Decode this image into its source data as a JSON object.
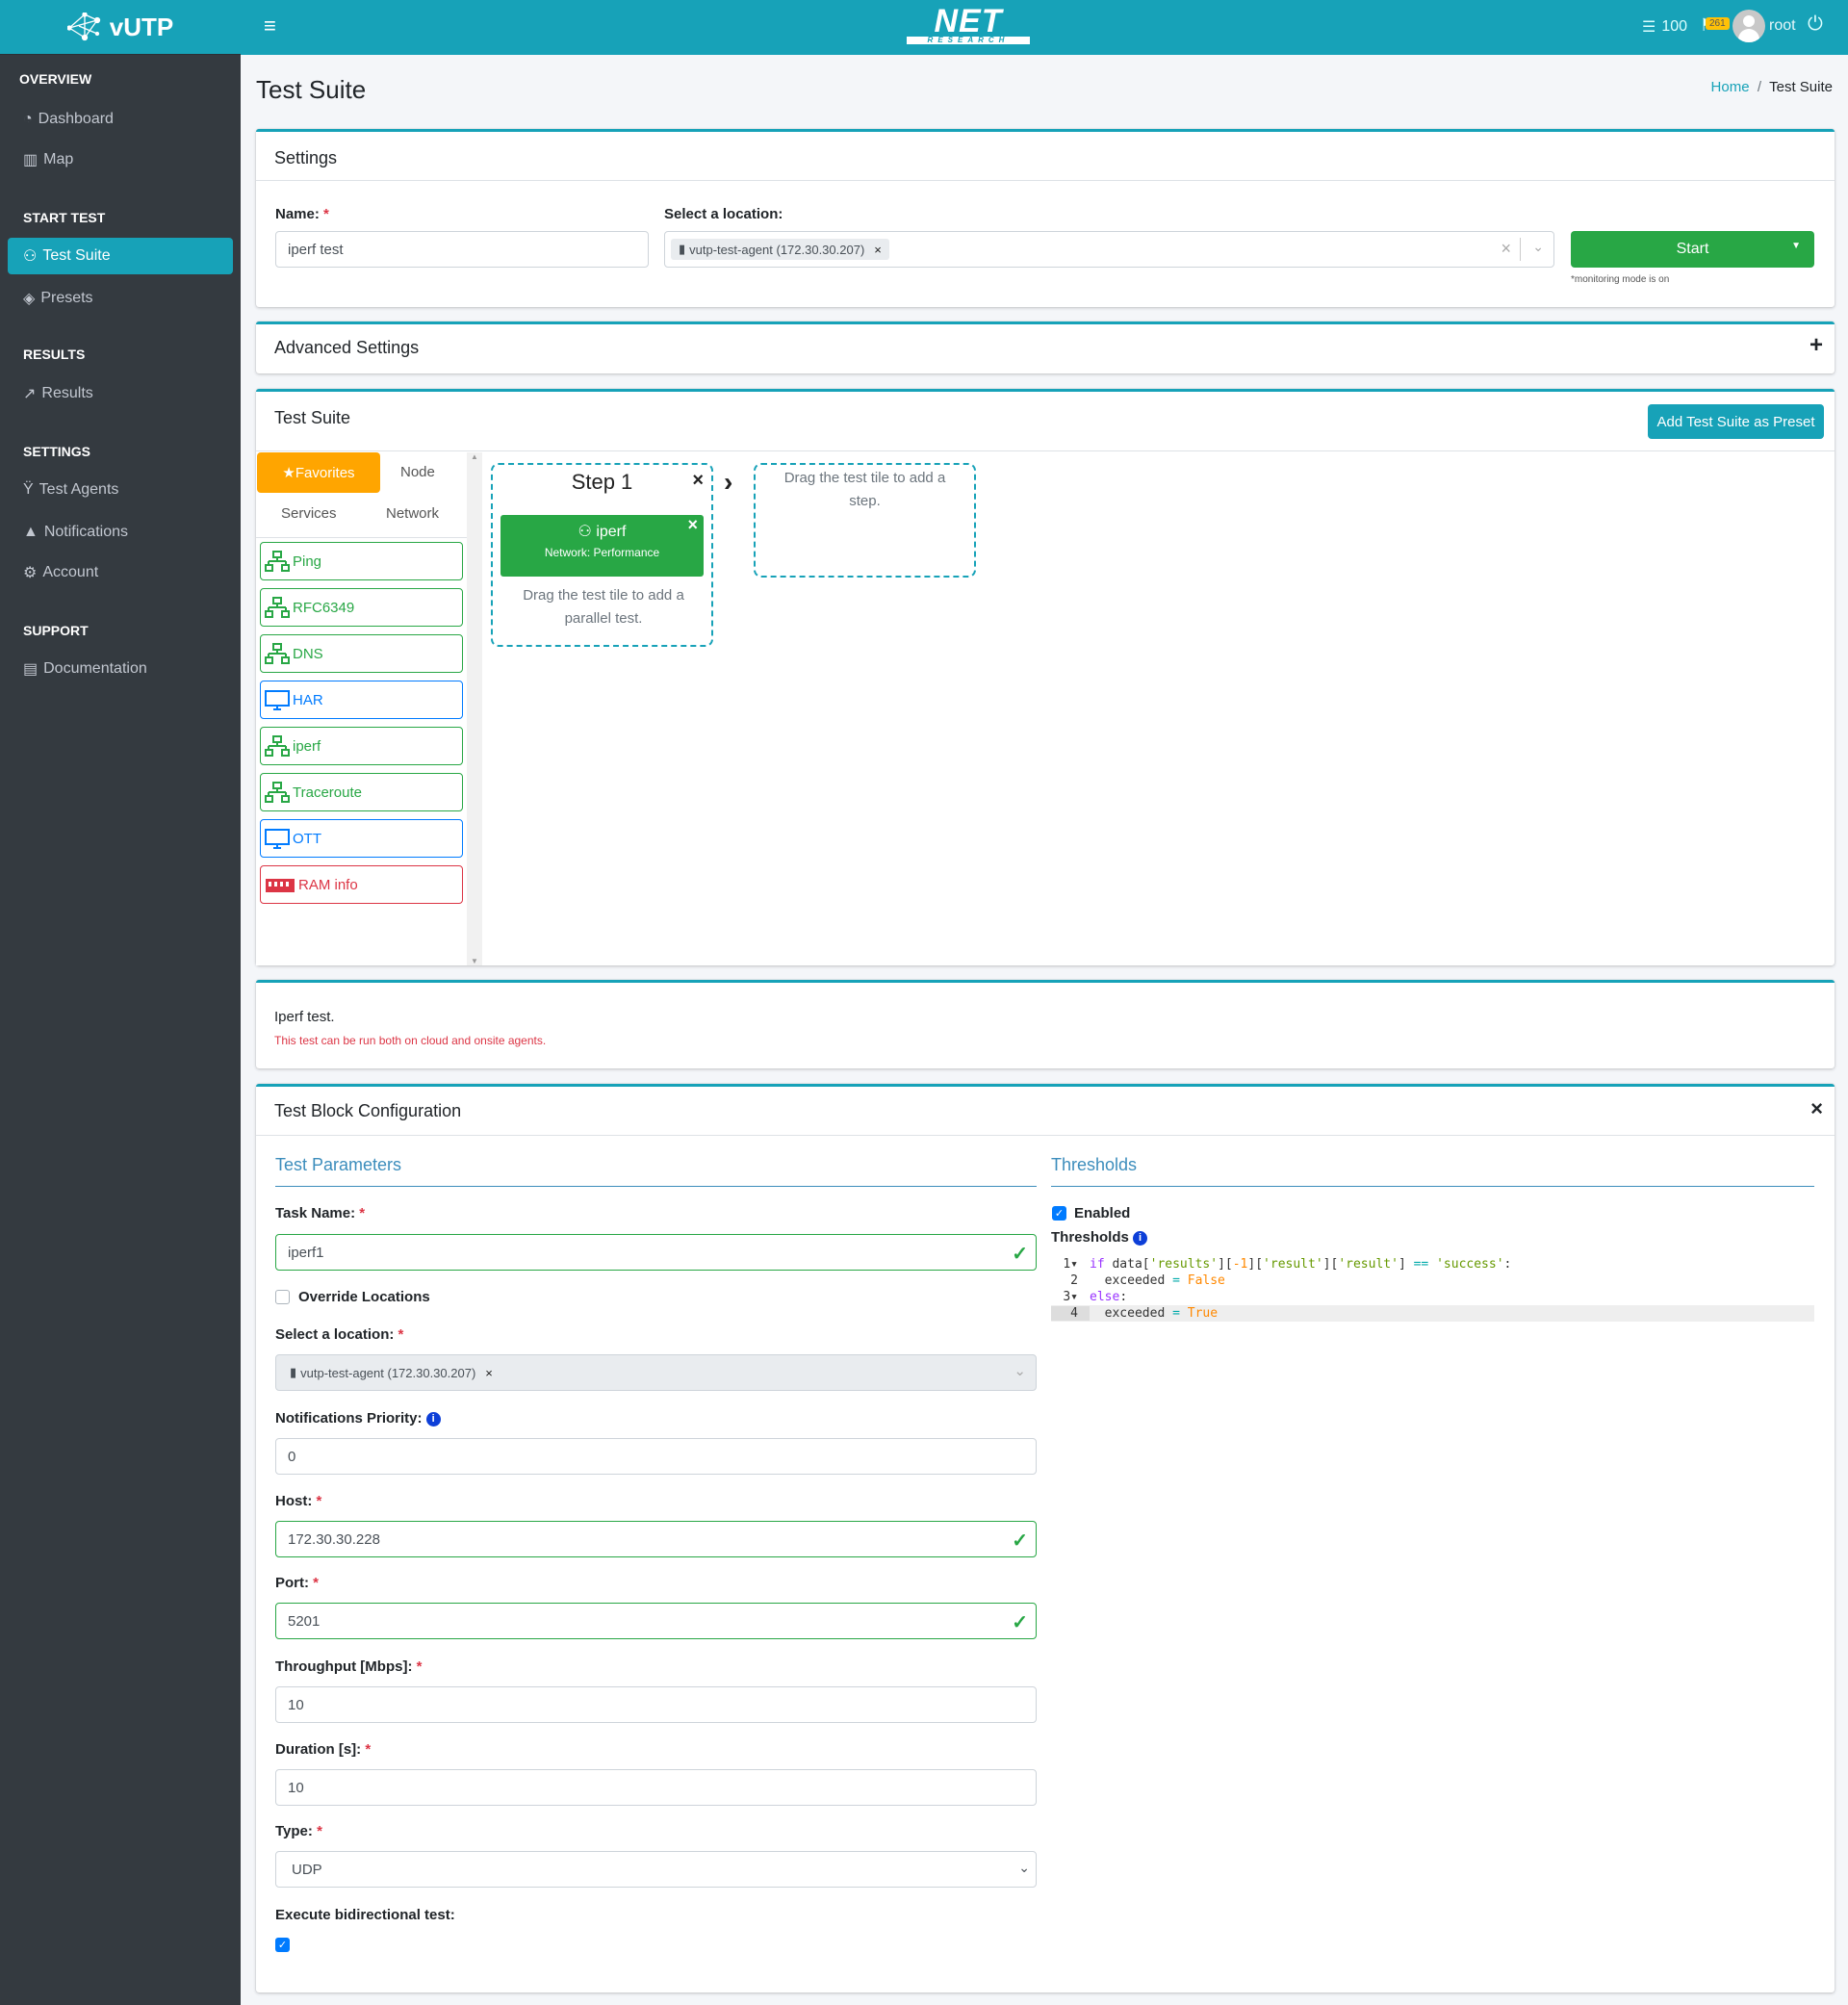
{
  "brand": {
    "name": "vUTP"
  },
  "topbar": {
    "logo": "NET RESEARCH",
    "credits": "100",
    "notifications": "261",
    "user": "root",
    "icons": [
      "menu-icon",
      "database-icon",
      "flag-icon",
      "avatar",
      "power-icon"
    ]
  },
  "sidebar": {
    "overview": "OVERVIEW",
    "dashboard": "Dashboard",
    "map": "Map",
    "start_test": "START TEST",
    "test_suite": "Test Suite",
    "presets": "Presets",
    "results_header": "RESULTS",
    "results": "Results",
    "settings_header": "SETTINGS",
    "test_agents": "Test Agents",
    "notifications": "Notifications",
    "account": "Account",
    "support": "SUPPORT",
    "documentation": "Documentation"
  },
  "page": {
    "title": "Test Suite",
    "breadcrumb": [
      "Home",
      "Test Suite"
    ]
  },
  "settings": {
    "title": "Settings",
    "name_label": "Name:",
    "name_value": "iperf test",
    "location_label": "Select a location:",
    "location_chip": "vutp-test-agent (172.30.30.207)",
    "start": "Start",
    "monitoring_note": "*monitoring mode is on"
  },
  "advanced": {
    "title": "Advanced Settings"
  },
  "suite": {
    "title": "Test Suite",
    "add_preset": "Add Test Suite as Preset",
    "tabs": [
      "Favorites",
      "Node",
      "Services",
      "Network"
    ],
    "tiles": [
      {
        "label": "Ping",
        "kind": "network"
      },
      {
        "label": "RFC6349",
        "kind": "network"
      },
      {
        "label": "DNS",
        "kind": "network"
      },
      {
        "label": "HAR",
        "kind": "monitor"
      },
      {
        "label": "iperf",
        "kind": "network"
      },
      {
        "label": "Traceroute",
        "kind": "network"
      },
      {
        "label": "OTT",
        "kind": "monitor"
      },
      {
        "label": "RAM info",
        "kind": "ram"
      }
    ],
    "step_title": "Step 1",
    "step_test": "iperf",
    "step_test_category": "Network: Performance",
    "parallel_hint": "Drag the test tile to add a parallel test.",
    "step_hint": "Drag the test tile to add a step."
  },
  "info": {
    "title": "Iperf test.",
    "note": "This test can be run both on cloud and onsite agents."
  },
  "config": {
    "title": "Test Block Configuration",
    "params_title": "Test Parameters",
    "task_name_label": "Task Name:",
    "task_name": "iperf1",
    "override_label": "Override Locations",
    "override_checked": false,
    "location_label": "Select a location:",
    "location_chip": "vutp-test-agent (172.30.30.207)",
    "priority_label": "Notifications Priority:",
    "priority": "0",
    "host_label": "Host:",
    "host": "172.30.30.228",
    "port_label": "Port:",
    "port": "5201",
    "throughput_label": "Throughput [Mbps]:",
    "throughput": "10",
    "duration_label": "Duration [s]:",
    "duration": "10",
    "type_label": "Type:",
    "type": "UDP",
    "bidir_label": "Execute bidirectional test:",
    "bidir_checked": true,
    "thresholds_title": "Thresholds",
    "enabled_label": "Enabled",
    "enabled_checked": true,
    "thresholds_label": "Thresholds",
    "code": [
      "if data['results'][-1]['result']['result'] == 'success':",
      "  exceeded = False",
      "else:",
      "  exceeded = True"
    ]
  }
}
